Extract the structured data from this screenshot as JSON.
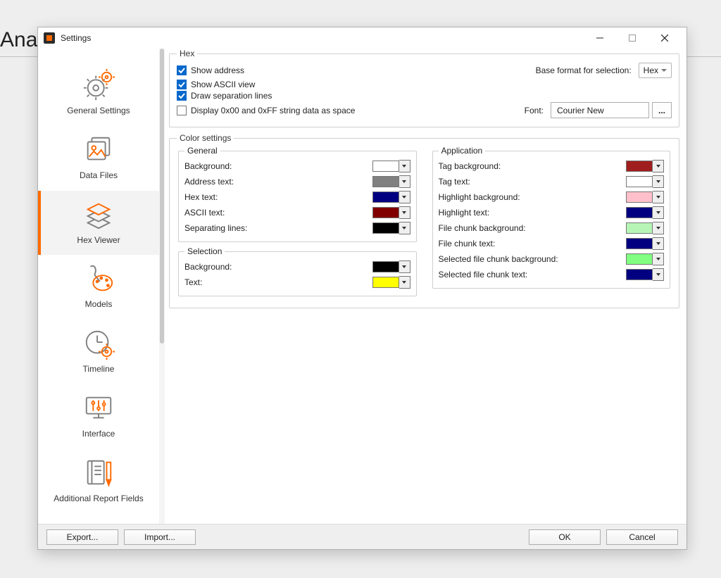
{
  "parent": {
    "title_fragment": "Anal"
  },
  "dialog": {
    "title": "Settings"
  },
  "sidebar": {
    "items": [
      {
        "id": "general-settings",
        "label": "General Settings"
      },
      {
        "id": "data-files",
        "label": "Data Files"
      },
      {
        "id": "hex-viewer",
        "label": "Hex Viewer"
      },
      {
        "id": "models",
        "label": "Models"
      },
      {
        "id": "timeline",
        "label": "Timeline"
      },
      {
        "id": "interface",
        "label": "Interface"
      },
      {
        "id": "additional-report-fields",
        "label": "Additional Report Fields"
      }
    ],
    "selected_index": 2
  },
  "hex_group": {
    "legend": "Hex",
    "show_address": {
      "label": "Show address",
      "checked": true
    },
    "show_ascii": {
      "label": "Show ASCII view",
      "checked": true
    },
    "draw_separation": {
      "label": "Draw separation lines",
      "checked": true
    },
    "display_as_space": {
      "label": "Display 0x00 and 0xFF string data as space",
      "checked": false
    },
    "base_format_label": "Base format for selection:",
    "base_format_value": "Hex",
    "font_label": "Font:",
    "font_value": "Courier New",
    "font_button": "..."
  },
  "color_settings": {
    "legend": "Color settings",
    "general": {
      "legend": "General",
      "rows": [
        {
          "label": "Background:",
          "color": "#ffffff"
        },
        {
          "label": "Address text:",
          "color": "#808080"
        },
        {
          "label": "Hex text:",
          "color": "#000080"
        },
        {
          "label": "ASCII text:",
          "color": "#800000"
        },
        {
          "label": "Separating lines:",
          "color": "#000000"
        }
      ]
    },
    "selection": {
      "legend": "Selection",
      "rows": [
        {
          "label": "Background:",
          "color": "#000000"
        },
        {
          "label": "Text:",
          "color": "#ffff00"
        }
      ]
    },
    "application": {
      "legend": "Application",
      "rows": [
        {
          "label": "Tag background:",
          "color": "#a01e1e"
        },
        {
          "label": "Tag text:",
          "color": "#ffffff"
        },
        {
          "label": "Highlight background:",
          "color": "#ffc0cb"
        },
        {
          "label": "Highlight text:",
          "color": "#000080"
        },
        {
          "label": "File chunk background:",
          "color": "#b6f5b6"
        },
        {
          "label": "File chunk text:",
          "color": "#000080"
        },
        {
          "label": "Selected file chunk background:",
          "color": "#80ff80"
        },
        {
          "label": "Selected file chunk text:",
          "color": "#000080"
        }
      ]
    }
  },
  "footer": {
    "export": "Export...",
    "import": "Import...",
    "ok": "OK",
    "cancel": "Cancel"
  },
  "icons": {
    "app": "app-icon",
    "minimize": "minimize-icon",
    "maximize": "maximize-icon",
    "close": "close-icon"
  }
}
